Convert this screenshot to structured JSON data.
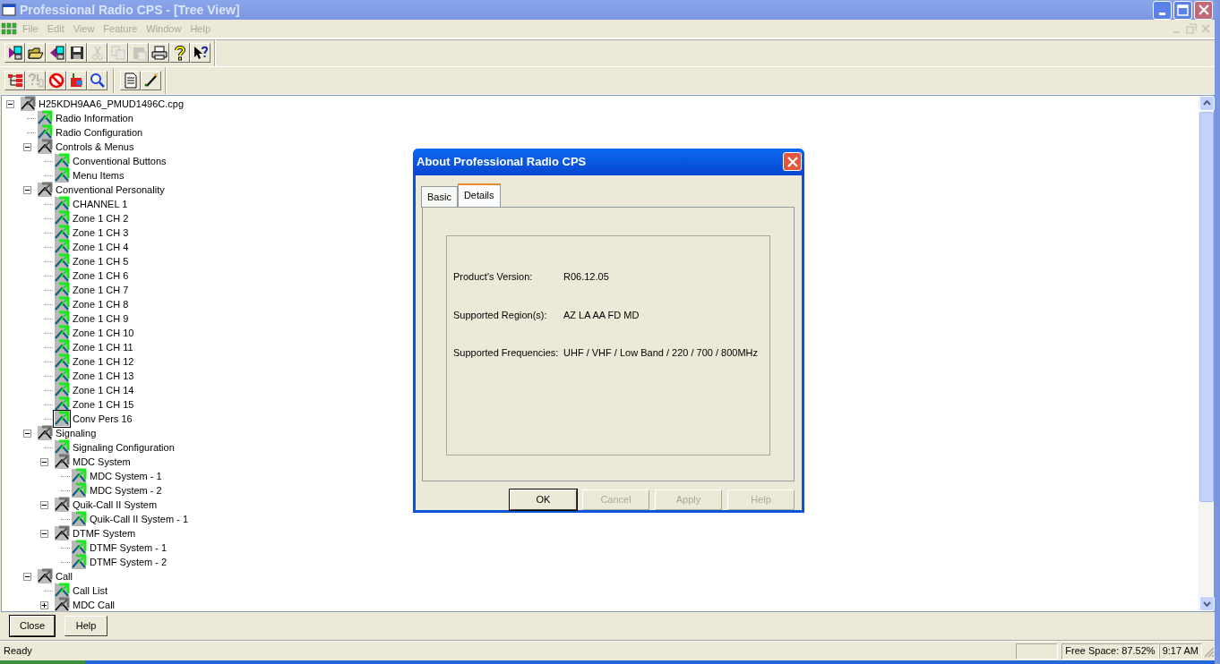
{
  "window": {
    "title": "Professional Radio CPS - [Tree View]",
    "active": false
  },
  "menu": [
    {
      "label": "File",
      "disabled": true
    },
    {
      "label": "Edit",
      "disabled": true
    },
    {
      "label": "View",
      "disabled": true
    },
    {
      "label": "Feature",
      "disabled": true
    },
    {
      "label": "Window",
      "disabled": true
    },
    {
      "label": "Help",
      "disabled": true
    }
  ],
  "toolbars": [
    [
      {
        "kind": "write",
        "disabled": false
      },
      {
        "kind": "open",
        "disabled": false
      },
      {
        "kind": "read",
        "disabled": false
      },
      {
        "kind": "save",
        "disabled": false
      },
      {
        "kind": "cut",
        "disabled": true
      },
      {
        "kind": "copy",
        "disabled": true
      },
      {
        "kind": "paste",
        "disabled": true
      },
      {
        "kind": "print",
        "disabled": false
      },
      {
        "kind": "help",
        "disabled": false
      },
      {
        "kind": "context-help",
        "disabled": false
      }
    ],
    [
      {
        "kind": "tree",
        "disabled": false
      },
      {
        "kind": "info",
        "disabled": true
      },
      {
        "kind": "block",
        "disabled": false
      },
      {
        "kind": "import",
        "disabled": false
      },
      {
        "kind": "search",
        "disabled": false
      },
      {
        "kind": "separator"
      },
      {
        "kind": "document",
        "disabled": false
      },
      {
        "kind": "wizard",
        "disabled": false
      }
    ]
  ],
  "tree": [
    {
      "label": "H25KDH9AA6_PMUD1496C.cpg",
      "kind": "folder",
      "selected": false,
      "expanded": true,
      "children": [
        {
          "label": "Radio Information",
          "kind": "leaf",
          "selected": false
        },
        {
          "label": "Radio Configuration",
          "kind": "leaf",
          "selected": false
        },
        {
          "label": "Controls & Menus",
          "kind": "folder",
          "selected": false,
          "expanded": true,
          "children": [
            {
              "label": "Conventional Buttons",
              "kind": "leaf",
              "selected": false
            },
            {
              "label": "Menu Items",
              "kind": "leaf",
              "selected": false
            }
          ]
        },
        {
          "label": "Conventional Personality",
          "kind": "folder",
          "selected": false,
          "expanded": true,
          "children": [
            {
              "label": "CHANNEL 1",
              "kind": "leaf",
              "selected": false
            },
            {
              "label": "Zone 1 CH 2",
              "kind": "leaf",
              "selected": false
            },
            {
              "label": "Zone 1 CH 3",
              "kind": "leaf",
              "selected": false
            },
            {
              "label": "Zone 1 CH 4",
              "kind": "leaf",
              "selected": false
            },
            {
              "label": "Zone 1 CH 5",
              "kind": "leaf",
              "selected": false
            },
            {
              "label": "Zone 1 CH 6",
              "kind": "leaf",
              "selected": false
            },
            {
              "label": "Zone 1 CH 7",
              "kind": "leaf",
              "selected": false
            },
            {
              "label": "Zone 1 CH 8",
              "kind": "leaf",
              "selected": false
            },
            {
              "label": "Zone 1 CH 9",
              "kind": "leaf",
              "selected": false
            },
            {
              "label": "Zone 1 CH 10",
              "kind": "leaf",
              "selected": false
            },
            {
              "label": "Zone 1 CH 11",
              "kind": "leaf",
              "selected": false
            },
            {
              "label": "Zone 1 CH 12",
              "kind": "leaf",
              "selected": false
            },
            {
              "label": "Zone 1 CH 13",
              "kind": "leaf",
              "selected": false
            },
            {
              "label": "Zone 1 CH 14",
              "kind": "leaf",
              "selected": false
            },
            {
              "label": "Zone 1 CH 15",
              "kind": "leaf",
              "selected": false
            },
            {
              "label": "Conv Pers 16",
              "kind": "leaf",
              "selected": true
            }
          ]
        },
        {
          "label": "Signaling",
          "kind": "folder",
          "selected": false,
          "expanded": true,
          "children": [
            {
              "label": "Signaling Configuration",
              "kind": "leaf",
              "selected": false
            },
            {
              "label": "MDC System",
              "kind": "folder",
              "selected": false,
              "expanded": true,
              "children": [
                {
                  "label": "MDC System - 1",
                  "kind": "leaf",
                  "selected": false
                },
                {
                  "label": "MDC System - 2",
                  "kind": "leaf",
                  "selected": false
                }
              ]
            },
            {
              "label": "Quik-Call II System",
              "kind": "folder",
              "selected": false,
              "expanded": true,
              "children": [
                {
                  "label": "Quik-Call II System - 1",
                  "kind": "leaf",
                  "selected": false
                }
              ]
            },
            {
              "label": "DTMF System",
              "kind": "folder",
              "selected": false,
              "expanded": true,
              "children": [
                {
                  "label": "DTMF System - 1",
                  "kind": "leaf",
                  "selected": false
                },
                {
                  "label": "DTMF System - 2",
                  "kind": "leaf",
                  "selected": false
                }
              ]
            }
          ]
        },
        {
          "label": "Call",
          "kind": "folder",
          "selected": false,
          "expanded": true,
          "children": [
            {
              "label": "Call List",
              "kind": "leaf",
              "selected": false
            },
            {
              "label": "MDC Call",
              "kind": "folder",
              "selected": false,
              "expanded": false
            }
          ]
        }
      ]
    }
  ],
  "bottom_buttons": [
    {
      "label": "Close",
      "default": true
    },
    {
      "label": "Help",
      "default": false
    }
  ],
  "status_bar": {
    "message": "Ready",
    "free_space": "Free Space: 87.52%",
    "time": "9:17 AM"
  },
  "dialog": {
    "title": "About Professional Radio CPS",
    "tabs": [
      {
        "label": "Basic",
        "selected": false
      },
      {
        "label": "Details",
        "selected": true
      }
    ],
    "fields": [
      {
        "label": "Product's Version:",
        "value": "R06.12.05"
      },
      {
        "label": "Supported Region(s):",
        "value": "AZ LA AA FD MD"
      },
      {
        "label": "Supported Frequencies:",
        "value": "UHF / VHF / Low Band / 220 / 700 / 800MHz"
      }
    ],
    "buttons": [
      {
        "label": "OK",
        "disabled": false,
        "default": true
      },
      {
        "label": "Cancel",
        "disabled": true,
        "default": false
      },
      {
        "label": "Apply",
        "disabled": true,
        "default": false
      },
      {
        "label": "Help",
        "disabled": true,
        "default": false
      }
    ]
  }
}
